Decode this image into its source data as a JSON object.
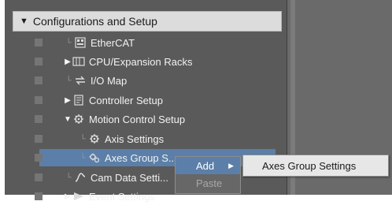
{
  "tree": {
    "header": "Configurations and Setup",
    "items": [
      {
        "label": "EtherCAT"
      },
      {
        "label": "CPU/Expansion Racks"
      },
      {
        "label": "I/O Map"
      },
      {
        "label": "Controller Setup"
      },
      {
        "label": "Motion Control Setup"
      },
      {
        "label": "Axis Settings"
      },
      {
        "label": "Axes Group S..."
      },
      {
        "label": "Cam Data Setti..."
      },
      {
        "label": "Event Settings"
      }
    ]
  },
  "context_menu": {
    "add": "Add",
    "paste": "Paste"
  },
  "submenu": {
    "item": "Axes Group Settings"
  },
  "colors": {
    "panel_bg": "#5a5a5a",
    "selection": "#5b7fa8",
    "header_bg": "#dcdcdc",
    "submenu_bg": "#e7e7e7"
  }
}
